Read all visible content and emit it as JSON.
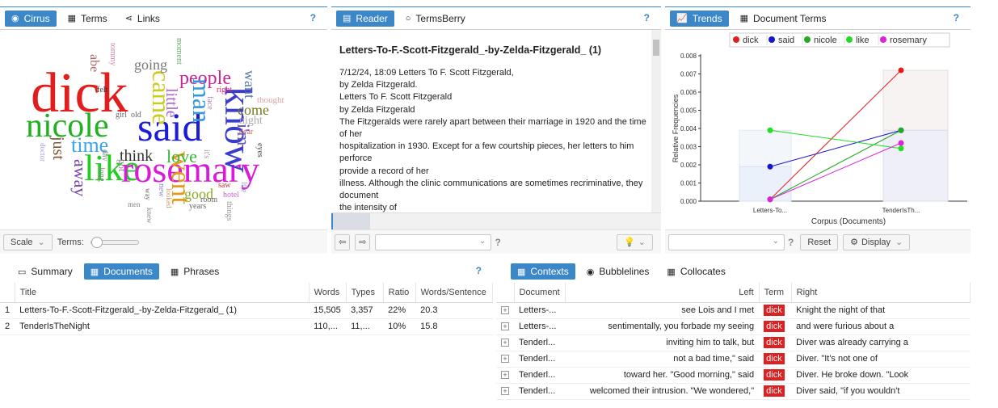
{
  "cirrus_panel": {
    "tabs": [
      "Cirrus",
      "Terms",
      "Links"
    ],
    "help": "?",
    "words": [
      {
        "t": "dick",
        "c": "#e11d1d",
        "v": false
      },
      {
        "t": "nicole",
        "c": "#20b020",
        "v": false
      },
      {
        "t": "said",
        "c": "#1b1bd8",
        "v": false
      },
      {
        "t": "like",
        "c": "#22cc22",
        "v": false
      },
      {
        "t": "rosemary",
        "c": "#d81bd8",
        "v": false
      },
      {
        "t": "time",
        "c": "#3aa6e6",
        "v": false
      },
      {
        "t": "people",
        "c": "#cc2299",
        "v": false
      },
      {
        "t": "know",
        "c": "#3b3bd0",
        "v": true
      },
      {
        "t": "man",
        "c": "#3399dd",
        "v": true
      },
      {
        "t": "came",
        "c": "#cccc22",
        "v": true
      },
      {
        "t": "went",
        "c": "#e69a1a",
        "v": true
      },
      {
        "t": "love",
        "c": "#33b833",
        "v": false
      },
      {
        "t": "think",
        "c": "#333333",
        "v": false
      },
      {
        "t": "going",
        "c": "#777777",
        "v": false
      },
      {
        "t": "little",
        "c": "#aa66cc",
        "v": true
      },
      {
        "t": "i'm",
        "c": "#6655bb",
        "v": true
      },
      {
        "t": "away",
        "c": "#7744aa",
        "v": true
      },
      {
        "t": "just",
        "c": "#775533",
        "v": true
      },
      {
        "t": "come",
        "c": "#777722",
        "v": false
      },
      {
        "t": "good",
        "c": "#88aa22",
        "v": false
      },
      {
        "t": "want",
        "c": "#5577aa",
        "v": true
      },
      {
        "t": "abe",
        "c": "#aa6666",
        "v": true
      },
      {
        "t": "felt",
        "c": "#333333",
        "v": false
      },
      {
        "t": "night",
        "c": "#aaaaaa",
        "v": false
      },
      {
        "t": "thought",
        "c": "#e0a0a0",
        "v": false
      },
      {
        "t": "right",
        "c": "#dd2266",
        "v": false
      },
      {
        "t": "moment",
        "c": "#66aa66",
        "v": true
      },
      {
        "t": "tommy",
        "c": "#cc88aa",
        "v": true
      },
      {
        "t": "girl",
        "c": "#666666",
        "v": false
      },
      {
        "t": "old",
        "c": "#666666",
        "v": false
      },
      {
        "t": "dear",
        "c": "#cc6666",
        "v": false
      },
      {
        "t": "eyes",
        "c": "#444444",
        "v": true
      },
      {
        "t": "face",
        "c": "#aa88aa",
        "v": true
      },
      {
        "t": "it's",
        "c": "#999999",
        "v": true
      },
      {
        "t": "way",
        "c": "#666666",
        "v": true
      },
      {
        "t": "new",
        "c": "#8888cc",
        "v": true
      },
      {
        "t": "looked",
        "c": "#cc9966",
        "v": true
      },
      {
        "t": "saw",
        "c": "#cc3333",
        "v": false
      },
      {
        "t": "hotel",
        "c": "#cc66cc",
        "v": false
      },
      {
        "t": "room",
        "c": "#666666",
        "v": false
      },
      {
        "t": "years",
        "c": "#666666",
        "v": false
      },
      {
        "t": "men",
        "c": "#888888",
        "v": false
      },
      {
        "t": "life",
        "c": "#9999cc",
        "v": true
      },
      {
        "t": "things",
        "c": "#999999",
        "v": true
      },
      {
        "t": "day",
        "c": "#888888",
        "v": true
      },
      {
        "t": "long",
        "c": "#888888",
        "v": true
      },
      {
        "t": "got",
        "c": "#888888",
        "v": true
      },
      {
        "t": "knew",
        "c": "#888888",
        "v": true
      },
      {
        "t": "doctor",
        "c": "#9999dd",
        "v": true
      }
    ],
    "footer": {
      "scale_label": "Scale",
      "terms_label": "Terms:"
    }
  },
  "reader_panel": {
    "tabs": [
      "Reader",
      "TermsBerry"
    ],
    "help": "?",
    "title": "Letters-To-F.-Scott-Fitzgerald_-by-Zelda-Fitzgerald_ (1)",
    "lines": [
      "7/12/24, 18:09 Letters To F. Scott Fitzgerald,",
      "by Zelda Fitzgerald.",
      "Letters To F. Scott Fitzgerald",
      "by Zelda Fitzgerald",
      "The Fitzgeralds were rarely apart between their marriage in 1920 and the time of her",
      "hospitalization in 1930. Except for a few courtship pieces, her letters to him perforce",
      "provide a record of her",
      "illness. Although the clinic communications are sometimes recriminative, they document",
      "the intensity of"
    ]
  },
  "trends_panel": {
    "tabs": [
      "Trends",
      "Document Terms"
    ],
    "help": "?",
    "footer": {
      "reset": "Reset",
      "display": "Display"
    }
  },
  "chart_data": {
    "type": "line",
    "categories": [
      "Letters-To...",
      "TenderIsTh..."
    ],
    "xlabel": "Corpus (Documents)",
    "ylabel": "Relative Frequencies",
    "ylim": [
      0,
      0.008
    ],
    "yticks": [
      "0.000",
      "0.001",
      "0.002",
      "0.003",
      "0.004",
      "0.005",
      "0.006",
      "0.007",
      "0.008"
    ],
    "legend_position": "top",
    "series": [
      {
        "name": "dick",
        "color": "#e02020",
        "values": [
          0.0001,
          0.0072
        ]
      },
      {
        "name": "said",
        "color": "#1515d0",
        "values": [
          0.0019,
          0.0039
        ]
      },
      {
        "name": "nicole",
        "color": "#22aa22",
        "values": [
          0.0001,
          0.0039
        ]
      },
      {
        "name": "like",
        "color": "#22dd22",
        "values": [
          0.0039,
          0.0029
        ]
      },
      {
        "name": "rosemary",
        "color": "#dd22dd",
        "values": [
          0.0001,
          0.0032
        ]
      }
    ]
  },
  "summary_panel": {
    "tabs": [
      "Summary",
      "Documents",
      "Phrases"
    ],
    "help": "?",
    "columns": [
      "Title",
      "Words",
      "Types",
      "Ratio",
      "Words/Sentence"
    ],
    "rows": [
      {
        "n": "1",
        "title": "Letters-To-F.-Scott-Fitzgerald_-by-Zelda-Fitzgerald_ (1)",
        "words": "15,505",
        "types": "3,357",
        "ratio": "22%",
        "wps": "20.3"
      },
      {
        "n": "2",
        "title": "TenderIsTheNight",
        "words": "110,...",
        "types": "11,...",
        "ratio": "10%",
        "wps": "15.8"
      }
    ]
  },
  "contexts_panel": {
    "tabs": [
      "Contexts",
      "Bubblelines",
      "Collocates"
    ],
    "columns": [
      "Document",
      "Left",
      "Term",
      "Right"
    ],
    "rows": [
      {
        "doc": "Letters-...",
        "left": "see Lois and I met",
        "term": "dick",
        "right": "Knight the night of that"
      },
      {
        "doc": "Letters-...",
        "left": "sentimentally, you forbade my seeing",
        "term": "dick",
        "right": "and were furious about a"
      },
      {
        "doc": "Tenderl...",
        "left": "inviting him to talk, but",
        "term": "dick",
        "right": "Diver was already carrying a"
      },
      {
        "doc": "Tenderl...",
        "left": "not a bad time,\" said",
        "term": "dick",
        "right": "Diver. \"It's not one of"
      },
      {
        "doc": "Tenderl...",
        "left": "toward her. \"Good morning,\" said",
        "term": "dick",
        "right": "Diver. He broke down. \"Look"
      },
      {
        "doc": "Tenderl...",
        "left": "welcomed their intrusion. \"We wondered,\"",
        "term": "dick",
        "right": "Diver said, \"if you wouldn't"
      }
    ]
  }
}
